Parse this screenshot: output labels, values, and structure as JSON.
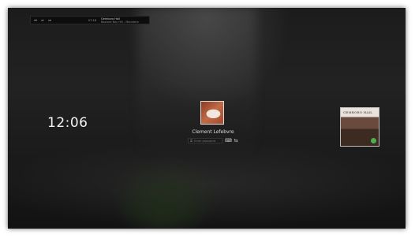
{
  "media_player": {
    "prev_icon": "prev-icon",
    "play_icon": "play-icon",
    "next_icon": "next-icon",
    "time": "07:18",
    "track_title": "Gemboro Hail",
    "track_subtitle": "Bastard Boy Hill - Monstera"
  },
  "clock": {
    "time": "12:06"
  },
  "user": {
    "name": "Clement Lefebvre"
  },
  "password": {
    "placeholder": "Enter password"
  },
  "album": {
    "title": "GEMBORO HAIL"
  },
  "colors": {
    "background": "#1c1c1c",
    "text": "#f2f2f2",
    "album_badge": "#4caf50"
  }
}
